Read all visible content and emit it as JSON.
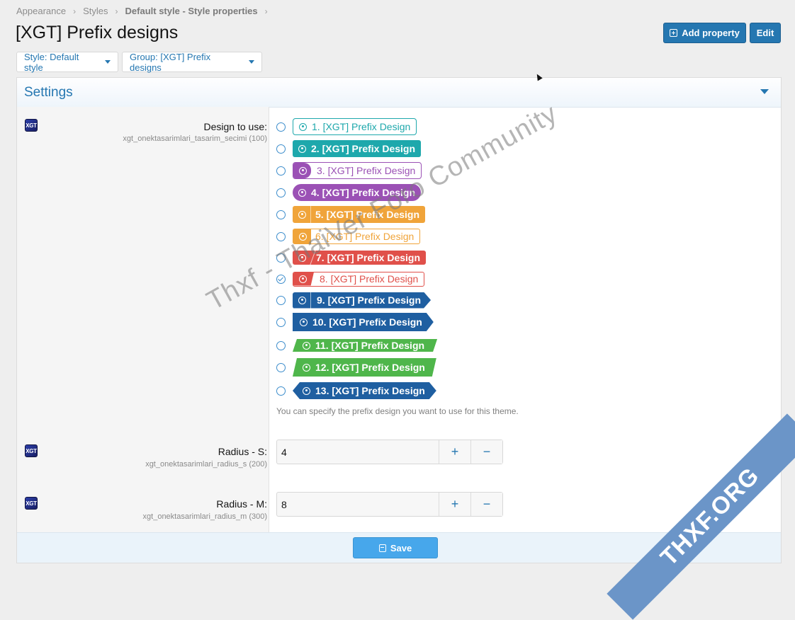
{
  "breadcrumb": {
    "items": [
      "Appearance",
      "Styles",
      "Default style - Style properties"
    ],
    "separator": "›"
  },
  "page": {
    "title": "[XGT] Prefix designs"
  },
  "header_buttons": {
    "add_property": "Add property",
    "edit": "Edit"
  },
  "filters": {
    "style": "Style: Default style",
    "group": "Group: [XGT] Prefix designs"
  },
  "panel": {
    "title": "Settings"
  },
  "icon_text": "XGT",
  "design_field": {
    "label": "Design to use:",
    "hint": "xgt_onektasarimlari_tasarim_secimi (100)",
    "options": [
      "1. [XGT] Prefix Design",
      "2. [XGT] Prefix Design",
      "3. [XGT] Prefix Design",
      "4. [XGT] Prefix Design",
      "5. [XGT] Prefix Design",
      "6. [XGT] Prefix Design",
      "7. [XGT] Prefix Design",
      "8. [XGT] Prefix Design",
      "9. [XGT] Prefix Design",
      "10. [XGT] Prefix Design",
      "11. [XGT] Prefix Design",
      "12. [XGT] Prefix Design",
      "13. [XGT] Prefix Design"
    ],
    "selected": "8. [XGT] Prefix Design",
    "explain": "You can specify the prefix design you want to use for this theme."
  },
  "radius_s": {
    "label": "Radius - S:",
    "hint": "xgt_onektasarimlari_radius_s (200)",
    "value": "4"
  },
  "radius_m": {
    "label": "Radius - M:",
    "hint": "xgt_onektasarimlari_radius_m (300)",
    "value": "8"
  },
  "stepper": {
    "plus": "+",
    "minus": "−"
  },
  "footer": {
    "save": "Save"
  },
  "watermark": "Thxf - ThaiVer Foro Community",
  "corner_badge": "THXF.ORG",
  "colors": {
    "primary": "#2577b1",
    "teal": "#1ea8ac",
    "purple": "#9b51b5",
    "orange": "#f0a43a",
    "red": "#e0504a",
    "navy": "#1f5fa1",
    "green": "#4fb64b"
  }
}
